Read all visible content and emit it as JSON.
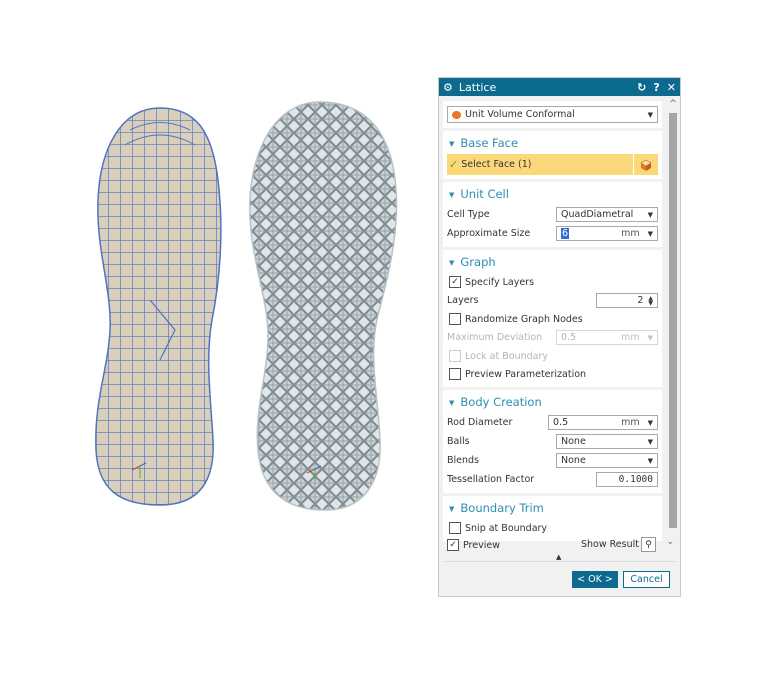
{
  "dialog": {
    "title": "Lattice",
    "title_icon": "gear-icon",
    "reset_icon": "reset-icon",
    "help_label": "?",
    "close_label": "✕",
    "type_select": "Unit Volume Conformal",
    "sections": {
      "base_face": {
        "title": "Base Face",
        "select_face_label": "Select Face (1)"
      },
      "unit_cell": {
        "title": "Unit Cell",
        "cell_type_label": "Cell Type",
        "cell_type_value": "QuadDiametral",
        "approx_size_label": "Approximate Size",
        "approx_size_value": "6",
        "approx_size_unit": "mm"
      },
      "graph": {
        "title": "Graph",
        "specify_layers_label": "Specify Layers",
        "specify_layers_checked": true,
        "layers_label": "Layers",
        "layers_value": "2",
        "randomize_label": "Randomize Graph Nodes",
        "randomize_checked": false,
        "max_dev_label": "Maximum Deviation",
        "max_dev_value": "0.5",
        "max_dev_unit": "mm",
        "lock_boundary_label": "Lock at Boundary",
        "preview_param_label": "Preview Parameterization"
      },
      "body_creation": {
        "title": "Body Creation",
        "rod_diameter_label": "Rod Diameter",
        "rod_diameter_value": "0.5",
        "rod_diameter_unit": "mm",
        "balls_label": "Balls",
        "balls_value": "None",
        "blends_label": "Blends",
        "blends_value": "None",
        "tess_label": "Tessellation Factor",
        "tess_value": "0.1000"
      },
      "boundary_trim": {
        "title": "Boundary Trim",
        "snip_label": "Snip at Boundary"
      }
    },
    "footer": {
      "preview_label": "Preview",
      "preview_checked": true,
      "show_result_label": "Show Result",
      "ok_label": "< OK >",
      "cancel_label": "Cancel"
    }
  },
  "scene": {
    "left_model": "Insole with conformal quad mesh",
    "right_model": "Lattice insole (QuadDiametral)"
  }
}
